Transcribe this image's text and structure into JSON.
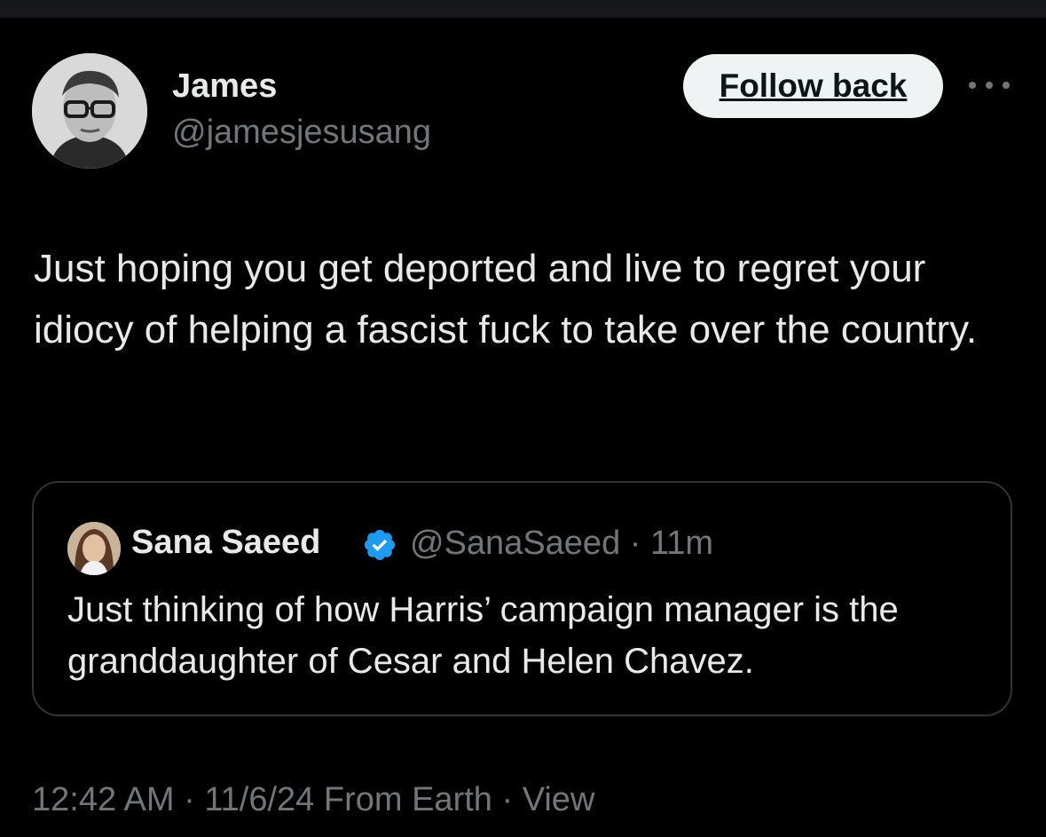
{
  "author": {
    "name": "James",
    "handle": "@jamesjesusang"
  },
  "follow_button": {
    "label": "Follow back"
  },
  "more_icon": "more-horizontal-icon",
  "tweet": {
    "text": "Just hoping you get deported and live to regret your idiocy of helping a fascist fuck to take over the country."
  },
  "quote": {
    "name": "Sana Saeed",
    "verified_icon": "verified-badge-icon",
    "handle": "@SanaSaeed",
    "separator": "·",
    "time_ago": "11m",
    "text": "Just thinking of how Harris’ campaign manager is the granddaughter of Cesar and Helen Chavez."
  },
  "footer": {
    "time": "12:42 AM",
    "separator_1": "·",
    "date": "11/6/24",
    "source": "From Earth",
    "separator_2": "·",
    "view_label": "View"
  },
  "colors": {
    "background": "#000000",
    "primary_text": "#e7e9ea",
    "secondary_text": "#71767b",
    "border": "#2f3336",
    "verified_blue": "#1d9bf0",
    "button_bg": "#eff3f4"
  }
}
